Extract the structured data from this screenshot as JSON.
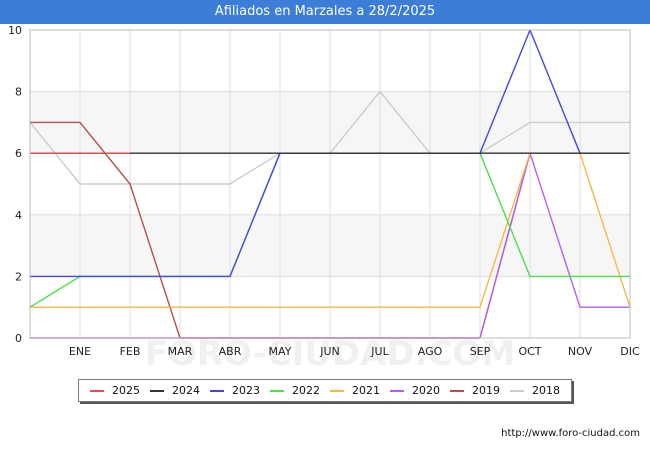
{
  "chart_data": {
    "type": "line",
    "title": "Afiliados en Marzales a 28/2/2025",
    "categories": [
      "",
      "ENE",
      "FEB",
      "MAR",
      "ABR",
      "MAY",
      "JUN",
      "JUL",
      "AGO",
      "SEP",
      "OCT",
      "NOV",
      "DIC"
    ],
    "ylim": [
      0,
      10
    ],
    "yticks": [
      0,
      2,
      4,
      6,
      8,
      10
    ],
    "grid": true,
    "legend_position": "bottom",
    "watermark": "FORO-CIUDAD.COM",
    "series": [
      {
        "name": "2025",
        "color": "#e05050",
        "values": [
          6,
          6,
          6,
          null,
          null,
          null,
          null,
          null,
          null,
          null,
          null,
          null,
          null
        ]
      },
      {
        "name": "2024",
        "color": "#333333",
        "values": [
          6,
          6,
          6,
          6,
          6,
          6,
          6,
          6,
          6,
          6,
          6,
          6,
          6
        ]
      },
      {
        "name": "2023",
        "color": "#4646e0",
        "values": [
          2,
          2,
          2,
          2,
          2,
          6,
          6,
          6,
          6,
          6,
          10,
          6,
          6
        ]
      },
      {
        "name": "2022",
        "color": "#4ae04a",
        "values": [
          1,
          2,
          2,
          2,
          2,
          6,
          6,
          6,
          6,
          6,
          2,
          2,
          2
        ]
      },
      {
        "name": "2021",
        "color": "#f5b942",
        "values": [
          1,
          1,
          1,
          1,
          1,
          1,
          1,
          1,
          1,
          1,
          6,
          6,
          1
        ]
      },
      {
        "name": "2020",
        "color": "#b45ef0",
        "values": [
          0,
          0,
          0,
          0,
          0,
          0,
          0,
          0,
          0,
          0,
          6,
          1,
          1
        ]
      },
      {
        "name": "2019",
        "color": "#b05050",
        "values": [
          7,
          7,
          5,
          0,
          0,
          0,
          0,
          0,
          0,
          0,
          6,
          null,
          null
        ]
      },
      {
        "name": "2018",
        "color": "#cccccc",
        "values": [
          7,
          5,
          5,
          5,
          5,
          6,
          6,
          8,
          6,
          6,
          7,
          7,
          7
        ]
      }
    ]
  },
  "footer": {
    "url": "http://www.foro-ciudad.com"
  }
}
